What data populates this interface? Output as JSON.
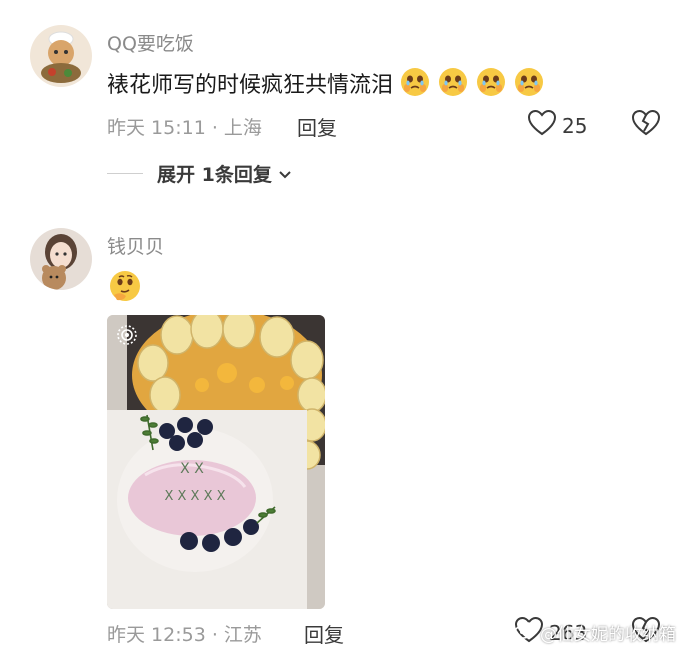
{
  "comments": [
    {
      "username": "QQ要吃饭",
      "content": "裱花师写的时候疯狂共情流泪",
      "emojis": [
        "crying-face-icon",
        "crying-face-icon",
        "crying-face-icon",
        "crying-face-icon"
      ],
      "time": "昨天 15:11 · 上海",
      "reply_label": "回复",
      "likes": "25",
      "expand_label": "展开 1条回复"
    },
    {
      "username": "钱贝贝",
      "emoji": "thinking-face-icon",
      "time": "昨天 12:53 · 江苏",
      "reply_label": "回复",
      "likes": "263"
    }
  ],
  "watermark": "@仙女妮的收纳箱",
  "colors": {
    "meta": "#9a9a9a",
    "username": "#8a8a8a",
    "cake_pink": "#e8c6d6",
    "blueberry": "#1f2540"
  }
}
